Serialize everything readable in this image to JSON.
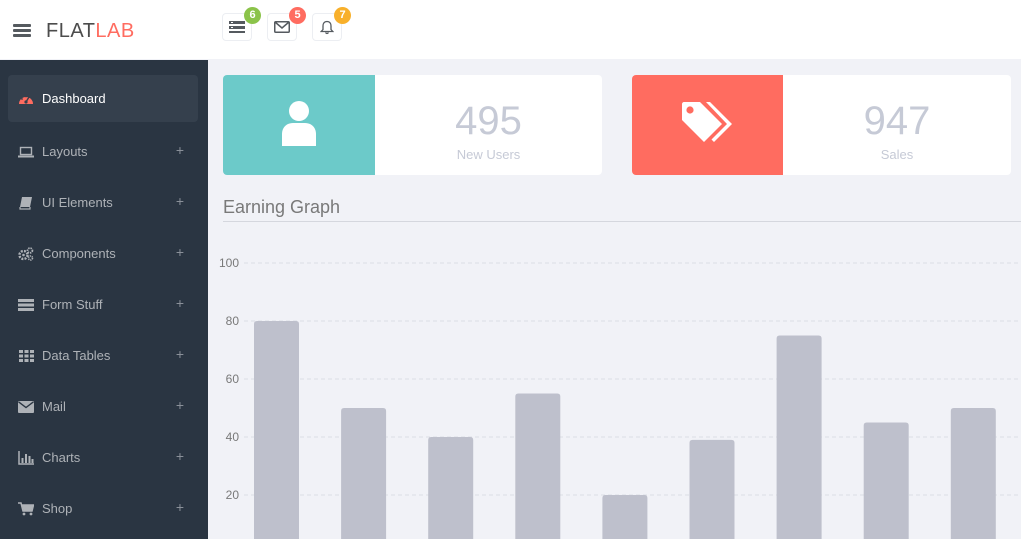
{
  "header": {
    "logo_part1": "FLAT",
    "logo_part2": "LAB",
    "notifications": [
      {
        "icon": "tasks-icon",
        "count": "6",
        "color": "#8bc34a"
      },
      {
        "icon": "envelope-icon",
        "count": "5",
        "color": "#ff6c60"
      },
      {
        "icon": "bell-icon",
        "count": "7",
        "color": "#f8b02b"
      }
    ]
  },
  "sidebar": {
    "items": [
      {
        "label": "Dashboard",
        "icon": "dashboard-icon",
        "active": true
      },
      {
        "label": "Layouts",
        "icon": "laptop-icon",
        "expand": "+"
      },
      {
        "label": "UI Elements",
        "icon": "book-icon",
        "expand": "+"
      },
      {
        "label": "Components",
        "icon": "cogs-icon",
        "expand": "+"
      },
      {
        "label": "Form Stuff",
        "icon": "form-icon",
        "expand": "+"
      },
      {
        "label": "Data Tables",
        "icon": "table-icon",
        "expand": "+"
      },
      {
        "label": "Mail",
        "icon": "envelope-icon",
        "expand": "+"
      },
      {
        "label": "Charts",
        "icon": "bar-chart-icon",
        "expand": "+"
      },
      {
        "label": "Shop",
        "icon": "cart-icon",
        "expand": "+"
      }
    ]
  },
  "stats": [
    {
      "value": "495",
      "label": "New Users",
      "icon": "user-icon",
      "color": "#6ccac9"
    },
    {
      "value": "947",
      "label": "Sales",
      "icon": "tags-icon",
      "color": "#ff6c60"
    }
  ],
  "graph": {
    "title": "Earning Graph"
  },
  "chart_data": {
    "type": "bar",
    "categories": [
      "",
      "",
      "",
      "",
      "",
      "",
      "",
      "",
      ""
    ],
    "values": [
      80,
      50,
      40,
      55,
      20,
      39,
      75,
      45,
      50
    ],
    "yticks": [
      20,
      40,
      60,
      80,
      100
    ],
    "ylim": [
      0,
      100
    ],
    "grid": true,
    "bar_color": "#bec0cc"
  }
}
